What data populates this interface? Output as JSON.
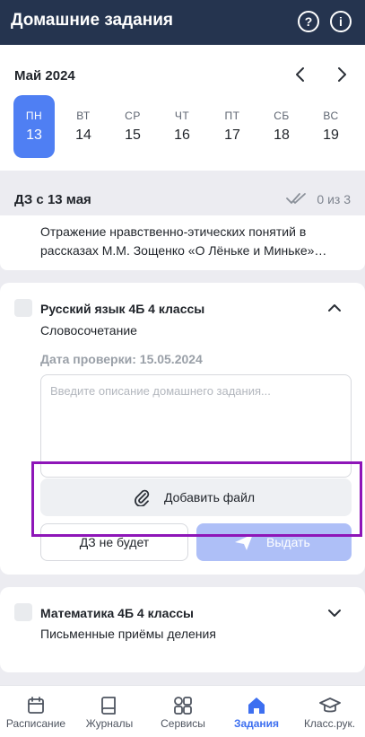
{
  "header": {
    "title": "Домашние задания",
    "help_icon": "question-circle-icon",
    "info_icon": "info-circle-icon"
  },
  "calendar": {
    "month": "Май 2024",
    "days": [
      {
        "name": "ПН",
        "date": "13",
        "selected": true
      },
      {
        "name": "ВТ",
        "date": "14",
        "selected": false
      },
      {
        "name": "СР",
        "date": "15",
        "selected": false
      },
      {
        "name": "ЧТ",
        "date": "16",
        "selected": false
      },
      {
        "name": "ПТ",
        "date": "17",
        "selected": false
      },
      {
        "name": "СБ",
        "date": "18",
        "selected": false
      },
      {
        "name": "ВС",
        "date": "19",
        "selected": false
      }
    ]
  },
  "homework": {
    "heading": "ДЗ с 13 мая",
    "count": "0 из 3",
    "previous_topic": "Отражение нравственно-этических понятий в рассказах М.М. Зощенко «О Лёньке и Миньке»…"
  },
  "subjects": [
    {
      "name": "Русский язык 4Б 4 классы",
      "topic": "Словосочетание",
      "check_date": "Дата проверки: 15.05.2024",
      "description_placeholder": "Введите описание домашнего задания...",
      "add_file_label": "Добавить файл",
      "no_homework_label": "ДЗ не будет",
      "issue_label": "Выдать"
    },
    {
      "name": "Математика 4Б 4 классы",
      "topic": "Письменные приёмы деления"
    }
  ],
  "tabs": [
    {
      "label": "Расписание",
      "icon": "calendar-icon",
      "active": false
    },
    {
      "label": "Журналы",
      "icon": "book-icon",
      "active": false
    },
    {
      "label": "Сервисы",
      "icon": "grid-icon",
      "active": false
    },
    {
      "label": "Задания",
      "icon": "home-icon",
      "active": true
    },
    {
      "label": "Класс.рук.",
      "icon": "graduation-cap-icon",
      "active": false
    }
  ],
  "colors": {
    "header_bg": "#25344f",
    "accent": "#4f7ff3",
    "issue_button_disabled": "#aebff7",
    "highlight_frame": "#8e16b8"
  }
}
